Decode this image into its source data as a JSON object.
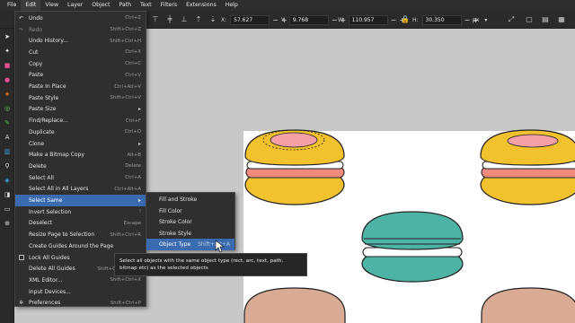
{
  "menubar": [
    "File",
    "Edit",
    "View",
    "Layer",
    "Object",
    "Path",
    "Text",
    "Filters",
    "Extensions",
    "Help"
  ],
  "coords": {
    "x_label": "X:",
    "x": "57.627",
    "y_label": "Y:",
    "y": "9.768",
    "w_label": "W:",
    "w": "110.957",
    "h_label": "H:",
    "h": "30.350",
    "unit": "px"
  },
  "edit_menu": [
    {
      "label": "Undo",
      "shortcut": "Ctrl+Z"
    },
    {
      "label": "Redo",
      "shortcut": "Shift+Ctrl+Z",
      "disabled": true
    },
    {
      "label": "Undo History...",
      "shortcut": "Shift+Ctrl+H"
    },
    {
      "label": "Cut",
      "shortcut": "Ctrl+X"
    },
    {
      "label": "Copy",
      "shortcut": "Ctrl+C"
    },
    {
      "label": "Paste",
      "shortcut": "Ctrl+V"
    },
    {
      "label": "Paste In Place",
      "shortcut": "Ctrl+Alt+V"
    },
    {
      "label": "Paste Style",
      "shortcut": "Shift+Ctrl+V"
    },
    {
      "label": "Paste Size",
      "submenu": true
    },
    {
      "label": "Find/Replace...",
      "shortcut": "Ctrl+F"
    },
    {
      "label": "Duplicate",
      "shortcut": "Ctrl+D"
    },
    {
      "label": "Clone",
      "submenu": true
    },
    {
      "label": "Make a Bitmap Copy",
      "shortcut": "Alt+B"
    },
    {
      "label": "Delete",
      "shortcut": "Delete"
    },
    {
      "label": "Select All",
      "shortcut": "Ctrl+A"
    },
    {
      "label": "Select All in All Layers",
      "shortcut": "Ctrl+Alt+A"
    },
    {
      "label": "Select Same",
      "submenu": true,
      "highlighted": true
    },
    {
      "label": "Invert Selection",
      "shortcut": "!"
    },
    {
      "label": "Deselect",
      "shortcut": "Escape"
    },
    {
      "label": "Resize Page to Selection",
      "shortcut": "Shift+Ctrl+R"
    },
    {
      "label": "Create Guides Around the Page",
      "shortcut": ""
    },
    {
      "label": "Lock All Guides",
      "shortcut": ""
    },
    {
      "label": "Delete All Guides",
      "shortcut": "Shift+Ctrl+Delete"
    },
    {
      "label": "XML Editor...",
      "shortcut": "Shift+Ctrl+X"
    },
    {
      "label": "Input Devices...",
      "shortcut": ""
    },
    {
      "label": "Preferences",
      "shortcut": "Shift+Ctrl+P"
    }
  ],
  "select_same_submenu": [
    {
      "label": "Fill and Stroke",
      "shortcut": ""
    },
    {
      "label": "Fill Color",
      "shortcut": ""
    },
    {
      "label": "Stroke Color",
      "shortcut": ""
    },
    {
      "label": "Stroke Style",
      "shortcut": ""
    },
    {
      "label": "Object Type",
      "shortcut": "Shift+Alt+A",
      "highlighted": true
    }
  ],
  "tooltip": "Select all objects with the same object type (rect, arc, text, path, bitmap etc) as the selected objects",
  "colors": {
    "accent": "#3a6bb0",
    "macaron_yellow": "#f2c12e",
    "macaron_pink": "#f08a7e",
    "macaron_teal": "#4cb3a5",
    "macaron_tan": "#d9ab95"
  }
}
